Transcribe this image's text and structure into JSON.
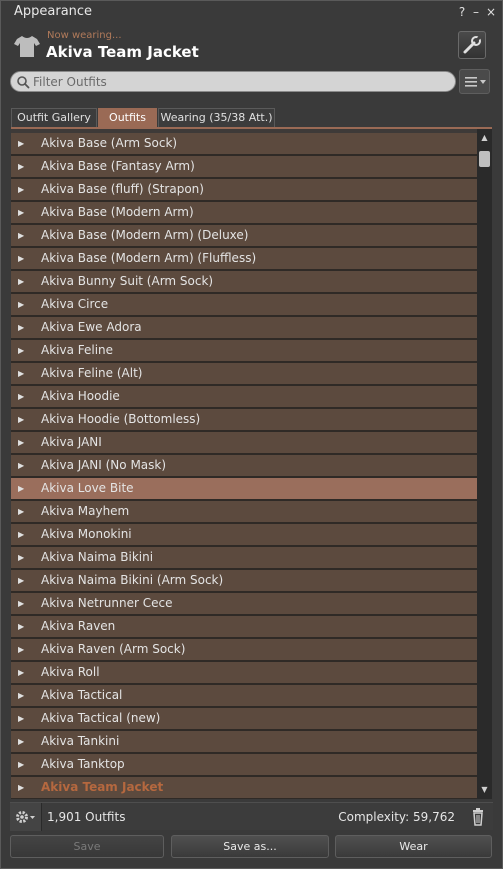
{
  "window": {
    "title": "Appearance",
    "help_label": "?",
    "minimize_label": "–",
    "close_label": "×"
  },
  "header": {
    "now_wearing_label": "Now wearing...",
    "outfit_name": "Akiva Team Jacket"
  },
  "filter": {
    "placeholder": "Filter Outfits",
    "value": ""
  },
  "tabs": [
    {
      "label": "Outfit Gallery",
      "active": false
    },
    {
      "label": "Outfits",
      "active": true
    },
    {
      "label": "Wearing (35/38 Att.)",
      "active": false
    }
  ],
  "outfits": [
    {
      "label": "Akiva Base (Arm Sock)"
    },
    {
      "label": "Akiva Base (Fantasy Arm)"
    },
    {
      "label": "Akiva Base (fluff) (Strapon)"
    },
    {
      "label": "Akiva Base (Modern Arm)"
    },
    {
      "label": "Akiva Base (Modern Arm) (Deluxe)"
    },
    {
      "label": "Akiva Base (Modern Arm) (Fluffless)"
    },
    {
      "label": "Akiva Bunny Suit (Arm Sock)"
    },
    {
      "label": "Akiva Circe"
    },
    {
      "label": "Akiva Ewe Adora"
    },
    {
      "label": "Akiva Feline"
    },
    {
      "label": "Akiva Feline (Alt)"
    },
    {
      "label": "Akiva Hoodie"
    },
    {
      "label": "Akiva Hoodie (Bottomless)"
    },
    {
      "label": "Akiva JANI"
    },
    {
      "label": "Akiva JANI (No Mask)"
    },
    {
      "label": "Akiva Love Bite",
      "selected": true
    },
    {
      "label": "Akiva Mayhem"
    },
    {
      "label": "Akiva Monokini"
    },
    {
      "label": "Akiva Naima Bikini"
    },
    {
      "label": "Akiva Naima Bikini (Arm Sock)"
    },
    {
      "label": "Akiva Netrunner Cece"
    },
    {
      "label": "Akiva Raven"
    },
    {
      "label": "Akiva Raven (Arm Sock)"
    },
    {
      "label": "Akiva Roll"
    },
    {
      "label": "Akiva Tactical"
    },
    {
      "label": "Akiva Tactical (new)"
    },
    {
      "label": "Akiva Tankini"
    },
    {
      "label": "Akiva Tanktop"
    },
    {
      "label": "Akiva Team Jacket",
      "current": true
    }
  ],
  "bottom": {
    "count_text": "1,901 Outfits",
    "complexity_text": "Complexity: 59,762"
  },
  "buttons": {
    "save_label": "Save",
    "save_as_label": "Save as...",
    "wear_label": "Wear"
  },
  "colors": {
    "accent": "#9a6a55",
    "row_bg": "#5c4a3e",
    "selected_row": "#9a6e5c",
    "current_outfit_text": "#b5683f"
  }
}
